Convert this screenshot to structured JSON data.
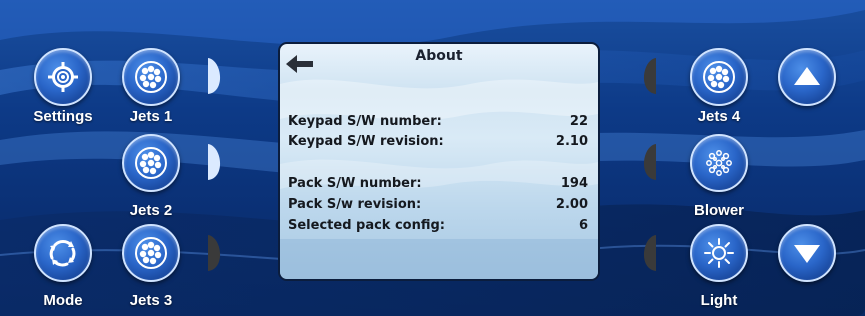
{
  "screen": {
    "title": "About",
    "rows": [
      {
        "label": "Keypad S/W number:",
        "value": "22"
      },
      {
        "label": "Keypad S/W revision:",
        "value": "2.10"
      },
      {
        "label": "Pack S/W number:",
        "value": "194"
      },
      {
        "label": "Pack S/w revision:",
        "value": "2.00"
      },
      {
        "label": "Selected pack config:",
        "value": "6"
      }
    ]
  },
  "buttons": {
    "settings": "Settings",
    "jets1": "Jets 1",
    "jets2": "Jets 2",
    "jets3": "Jets 3",
    "mode": "Mode",
    "jets4": "Jets 4",
    "blower": "Blower",
    "light": "Light"
  },
  "icons": {
    "settings": "gear-icon",
    "jets": "jet-nozzle-icon",
    "mode": "cycle-arrows-icon",
    "blower": "bubbles-icon",
    "light": "sun-icon",
    "up": "chevron-up-icon",
    "down": "chevron-down-icon",
    "back": "back-arrow-icon"
  },
  "colors": {
    "background": "#0d3a87",
    "button": "#2a66c9",
    "indicator_on": "#dbeaff",
    "indicator_off": "#3a3a3a",
    "screen": "#cfe3f2"
  },
  "indicators": {
    "jets1": "on",
    "jets2": "on",
    "jets3": "off",
    "jets4": "off",
    "blower": "off",
    "light": "off"
  }
}
